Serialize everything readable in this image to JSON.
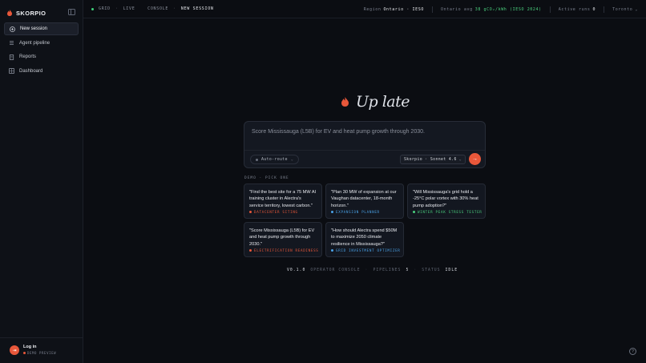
{
  "brand": {
    "name": "SKORPIO"
  },
  "sidebar": {
    "items": [
      {
        "label": "New session",
        "icon": "plus-circle-icon",
        "active": true
      },
      {
        "label": "Agent pipeline",
        "icon": "pipeline-icon",
        "active": false
      },
      {
        "label": "Reports",
        "icon": "document-icon",
        "active": false
      },
      {
        "label": "Dashboard",
        "icon": "grid-icon",
        "active": false
      }
    ],
    "login": {
      "label": "Log in",
      "sub": "DEMO PREVIEW"
    }
  },
  "topbar": {
    "crumbs": [
      "GRID",
      "LIVE",
      "CONSOLE",
      "NEW SESSION"
    ],
    "region_label": "Region",
    "region_value": "Ontario · IESO",
    "avg_label": "Ontario avg",
    "avg_value": "38 gCO₂/kWh (IESO 2024)",
    "active_runs_label": "Active runs",
    "active_runs_value": "0",
    "city": "Toronto"
  },
  "hero": {
    "title": "Up late"
  },
  "prompt": {
    "placeholder": "Score Mississauga (L5B) for EV and heat pump growth through 2030.",
    "auto_route": "Auto-route",
    "model": "Skorpio · Sonnet 4.6"
  },
  "demos": {
    "label": "DEMO · PICK ONE",
    "cards": [
      {
        "text": "\"Find the best site for a 75 MW AI training cluster in Alectra's service territory, lowest carbon.\"",
        "tag": "DATACENTER SITING"
      },
      {
        "text": "\"Plan 30 MW of expansion at our Vaughan datacenter, 18-month horizon.\"",
        "tag": "EXPANSION PLANNER"
      },
      {
        "text": "\"Will Mississauga's grid hold a -25°C polar vortex with 30% heat pump adoption?\"",
        "tag": "WINTER PEAK STRESS TESTER"
      },
      {
        "text": "\"Score Mississauga (L5B) for EV and heat pump growth through 2030.\"",
        "tag": "ELECTRIFICATION READINESS"
      },
      {
        "text": "\"How should Alectra spend $50M to maximize 2050 climate resilience in Mississauga?\"",
        "tag": "GRID INVESTMENT OPTIMIZER"
      }
    ]
  },
  "status": {
    "version": "V0.1.0",
    "console": "OPERATOR CONSOLE",
    "pipelines_label": "PIPELINES",
    "pipelines_value": "5",
    "status_label": "STATUS",
    "status_value": "IDLE"
  },
  "colors": {
    "accent": "#e8573a",
    "live": "#3ed17a",
    "blue": "#4aa3e8",
    "green": "#4ad07e"
  }
}
